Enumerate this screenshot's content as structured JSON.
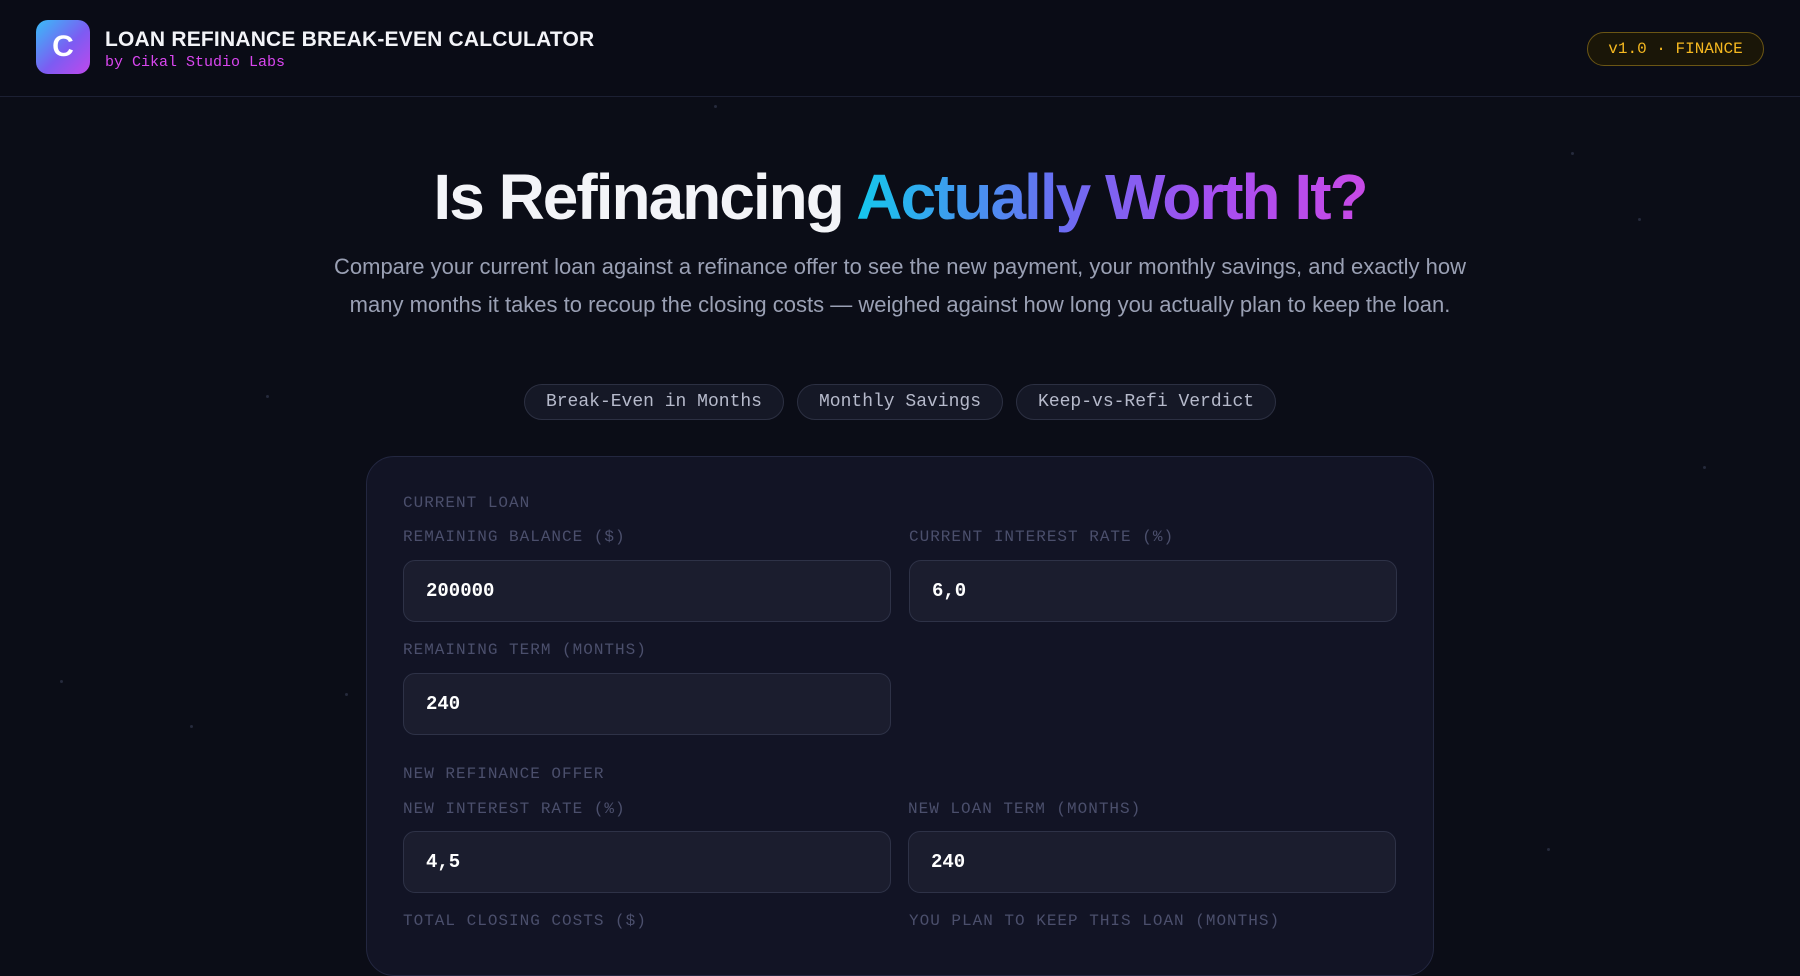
{
  "header": {
    "logo_letter": "C",
    "title": "LOAN REFINANCE BREAK-EVEN CALCULATOR",
    "subtitle": "by Cikal Studio Labs",
    "version_badge": "v1.0 · FINANCE"
  },
  "hero": {
    "title_plain": "Is Refinancing ",
    "title_accent": "Actually Worth It?",
    "description": "Compare your current loan against a refinance offer to see the new payment, your monthly savings, and exactly how many months it takes to recoup the closing costs — weighed against how long you actually plan to keep the loan."
  },
  "chips": [
    "Break-Even in Months",
    "Monthly Savings",
    "Keep-vs-Refi Verdict"
  ],
  "form": {
    "current_loan": {
      "section_label": "CURRENT LOAN",
      "balance_label": "REMAINING BALANCE ($)",
      "balance_value": "200000",
      "rate_label": "CURRENT INTEREST RATE (%)",
      "rate_value": "6,0",
      "term_label": "REMAINING TERM (MONTHS)",
      "term_value": "240"
    },
    "refinance": {
      "section_label": "NEW REFINANCE OFFER",
      "rate_label": "NEW INTEREST RATE (%)",
      "rate_value": "4,5",
      "term_label": "NEW LOAN TERM (MONTHS)",
      "term_value": "240",
      "closing_label": "TOTAL CLOSING COSTS ($)",
      "keep_label": "YOU PLAN TO KEEP THIS LOAN (MONTHS)"
    }
  },
  "colors": {
    "background": "#0b0d17",
    "panel": "#121425",
    "brand_magenta": "#d946ef",
    "badge_gold": "#f5b820",
    "accent_cyan": "#14c8ec",
    "accent_violet": "#a64ef0"
  }
}
